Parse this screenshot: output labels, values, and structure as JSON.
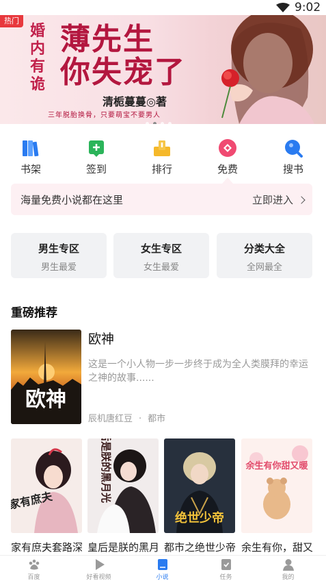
{
  "status_bar": {
    "time": "9:02"
  },
  "banner": {
    "tag": "热门",
    "side_text": [
      "婚",
      "内",
      "有",
      "诡"
    ],
    "title_line1": "薄先生",
    "title_line2": "你失宠了",
    "author": "清栀蔓蔓◎著",
    "slogan": "三年脱胎换骨，只要萌宝不要男人"
  },
  "nav": [
    {
      "label": "书架",
      "icon": "bookshelf-icon"
    },
    {
      "label": "签到",
      "icon": "checkin-icon"
    },
    {
      "label": "排行",
      "icon": "ranking-icon"
    },
    {
      "label": "免费",
      "icon": "free-icon"
    },
    {
      "label": "搜书",
      "icon": "search-book-icon"
    }
  ],
  "promo": {
    "text": "海量免费小说都在这里",
    "link": "立即进入"
  },
  "zones": [
    {
      "title": "男生专区",
      "subtitle": "男生最爱"
    },
    {
      "title": "女生专区",
      "subtitle": "女生最爱"
    },
    {
      "title": "分类大全",
      "subtitle": "全网最全"
    }
  ],
  "featured": {
    "section_title": "重磅推荐",
    "name": "欧神",
    "description": "这是一个小人物一步一步终于成为全人类膜拜的幸运之神的故事......",
    "author": "辰机唐红豆",
    "separator": "·",
    "category": "都市",
    "cover_title": "欧神"
  },
  "books": [
    {
      "title": "家有庶夫套路深",
      "cover_text": "家有庶夫"
    },
    {
      "title": "皇后是朕的黑月光",
      "cover_text": "皇后是朕的黑月光"
    },
    {
      "title": "都市之绝世少帝",
      "cover_text": "绝世少帝"
    },
    {
      "title": "余生有你，甜又暖",
      "cover_text": "余生有你甜又暖"
    }
  ],
  "tabs": [
    {
      "label": "百度",
      "icon": "paw-icon",
      "active": false
    },
    {
      "label": "好看视频",
      "icon": "play-icon",
      "active": false
    },
    {
      "label": "小说",
      "icon": "book-icon",
      "active": true
    },
    {
      "label": "任务",
      "icon": "task-icon",
      "active": false
    },
    {
      "label": "我的",
      "icon": "user-icon",
      "active": false
    }
  ],
  "colors": {
    "accent": "#2a7bf0",
    "banner_title": "#b3173f",
    "promo_bg": "#fdf0f3",
    "zone_bg": "#f1f2f4"
  }
}
